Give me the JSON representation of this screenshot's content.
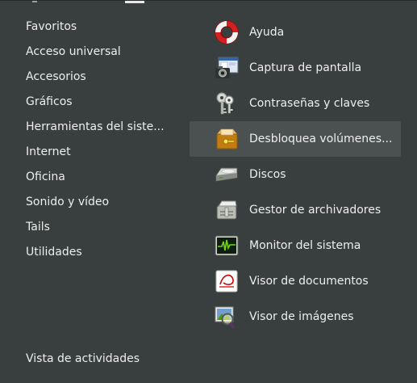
{
  "categories": [
    {
      "label": "Favoritos"
    },
    {
      "label": "Acceso universal"
    },
    {
      "label": "Accesorios"
    },
    {
      "label": "Gráficos"
    },
    {
      "label": "Herramientas del siste..."
    },
    {
      "label": "Internet"
    },
    {
      "label": "Oficina"
    },
    {
      "label": "Sonido y vídeo"
    },
    {
      "label": "Tails"
    },
    {
      "label": "Utilidades"
    }
  ],
  "activities_label": "Vista de actividades",
  "apps": [
    {
      "label": "Ayuda",
      "icon": "lifebuoy-icon"
    },
    {
      "label": "Captura de pantalla",
      "icon": "screenshot-camera-icon"
    },
    {
      "label": "Contraseñas y claves",
      "icon": "keys-icon"
    },
    {
      "label": "Desbloquea volúmenes...",
      "icon": "unlock-volume-icon",
      "highlighted": true
    },
    {
      "label": "Discos",
      "icon": "disks-icon"
    },
    {
      "label": "Gestor de archivadores",
      "icon": "archive-manager-icon"
    },
    {
      "label": "Monitor del sistema",
      "icon": "system-monitor-icon"
    },
    {
      "label": "Visor de documentos",
      "icon": "document-viewer-icon"
    },
    {
      "label": "Visor de imágenes",
      "icon": "image-viewer-icon"
    }
  ],
  "colors": {
    "background": "#393f3f",
    "text": "#eeeeec",
    "highlight": "#4b5151"
  }
}
